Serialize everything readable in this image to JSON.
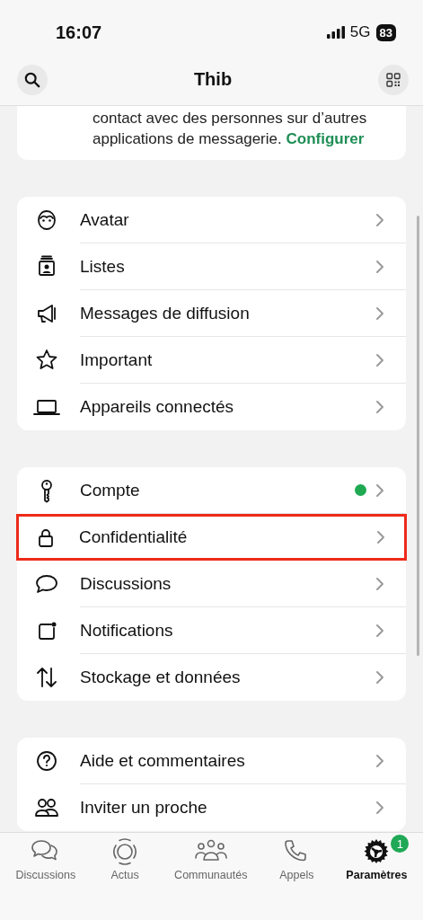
{
  "status_bar": {
    "time": "16:07",
    "network": "5G",
    "battery": "83"
  },
  "header": {
    "title": "Thib"
  },
  "notice_card": {
    "lines": [
      "contact avec des personnes sur d’autres",
      "applications de messagerie."
    ],
    "link": "Configurer"
  },
  "sections": [
    {
      "items": [
        {
          "label": "Avatar",
          "notice": false,
          "highlighted": false
        },
        {
          "label": "Listes",
          "notice": false,
          "highlighted": false
        },
        {
          "label": "Messages de diffusion",
          "notice": false,
          "highlighted": false
        },
        {
          "label": "Important",
          "notice": false,
          "highlighted": false
        },
        {
          "label": "Appareils connectés",
          "notice": false,
          "highlighted": false
        }
      ]
    },
    {
      "items": [
        {
          "label": "Compte",
          "notice": true,
          "highlighted": false
        },
        {
          "label": "Confidentialité",
          "notice": false,
          "highlighted": true
        },
        {
          "label": "Discussions",
          "notice": false,
          "highlighted": false
        },
        {
          "label": "Notifications",
          "notice": false,
          "highlighted": false
        },
        {
          "label": "Stockage et données",
          "notice": false,
          "highlighted": false
        }
      ]
    },
    {
      "items": [
        {
          "label": "Aide et commentaires",
          "notice": false,
          "highlighted": false
        },
        {
          "label": "Inviter un proche",
          "notice": false,
          "highlighted": false
        }
      ]
    }
  ],
  "tabs": [
    {
      "label": "Discussions",
      "selected": false
    },
    {
      "label": "Actus",
      "selected": false
    },
    {
      "label": "Communautés",
      "selected": false
    },
    {
      "label": "Appels",
      "selected": false
    },
    {
      "label": "Paramètres",
      "selected": true,
      "badge": "1"
    }
  ]
}
